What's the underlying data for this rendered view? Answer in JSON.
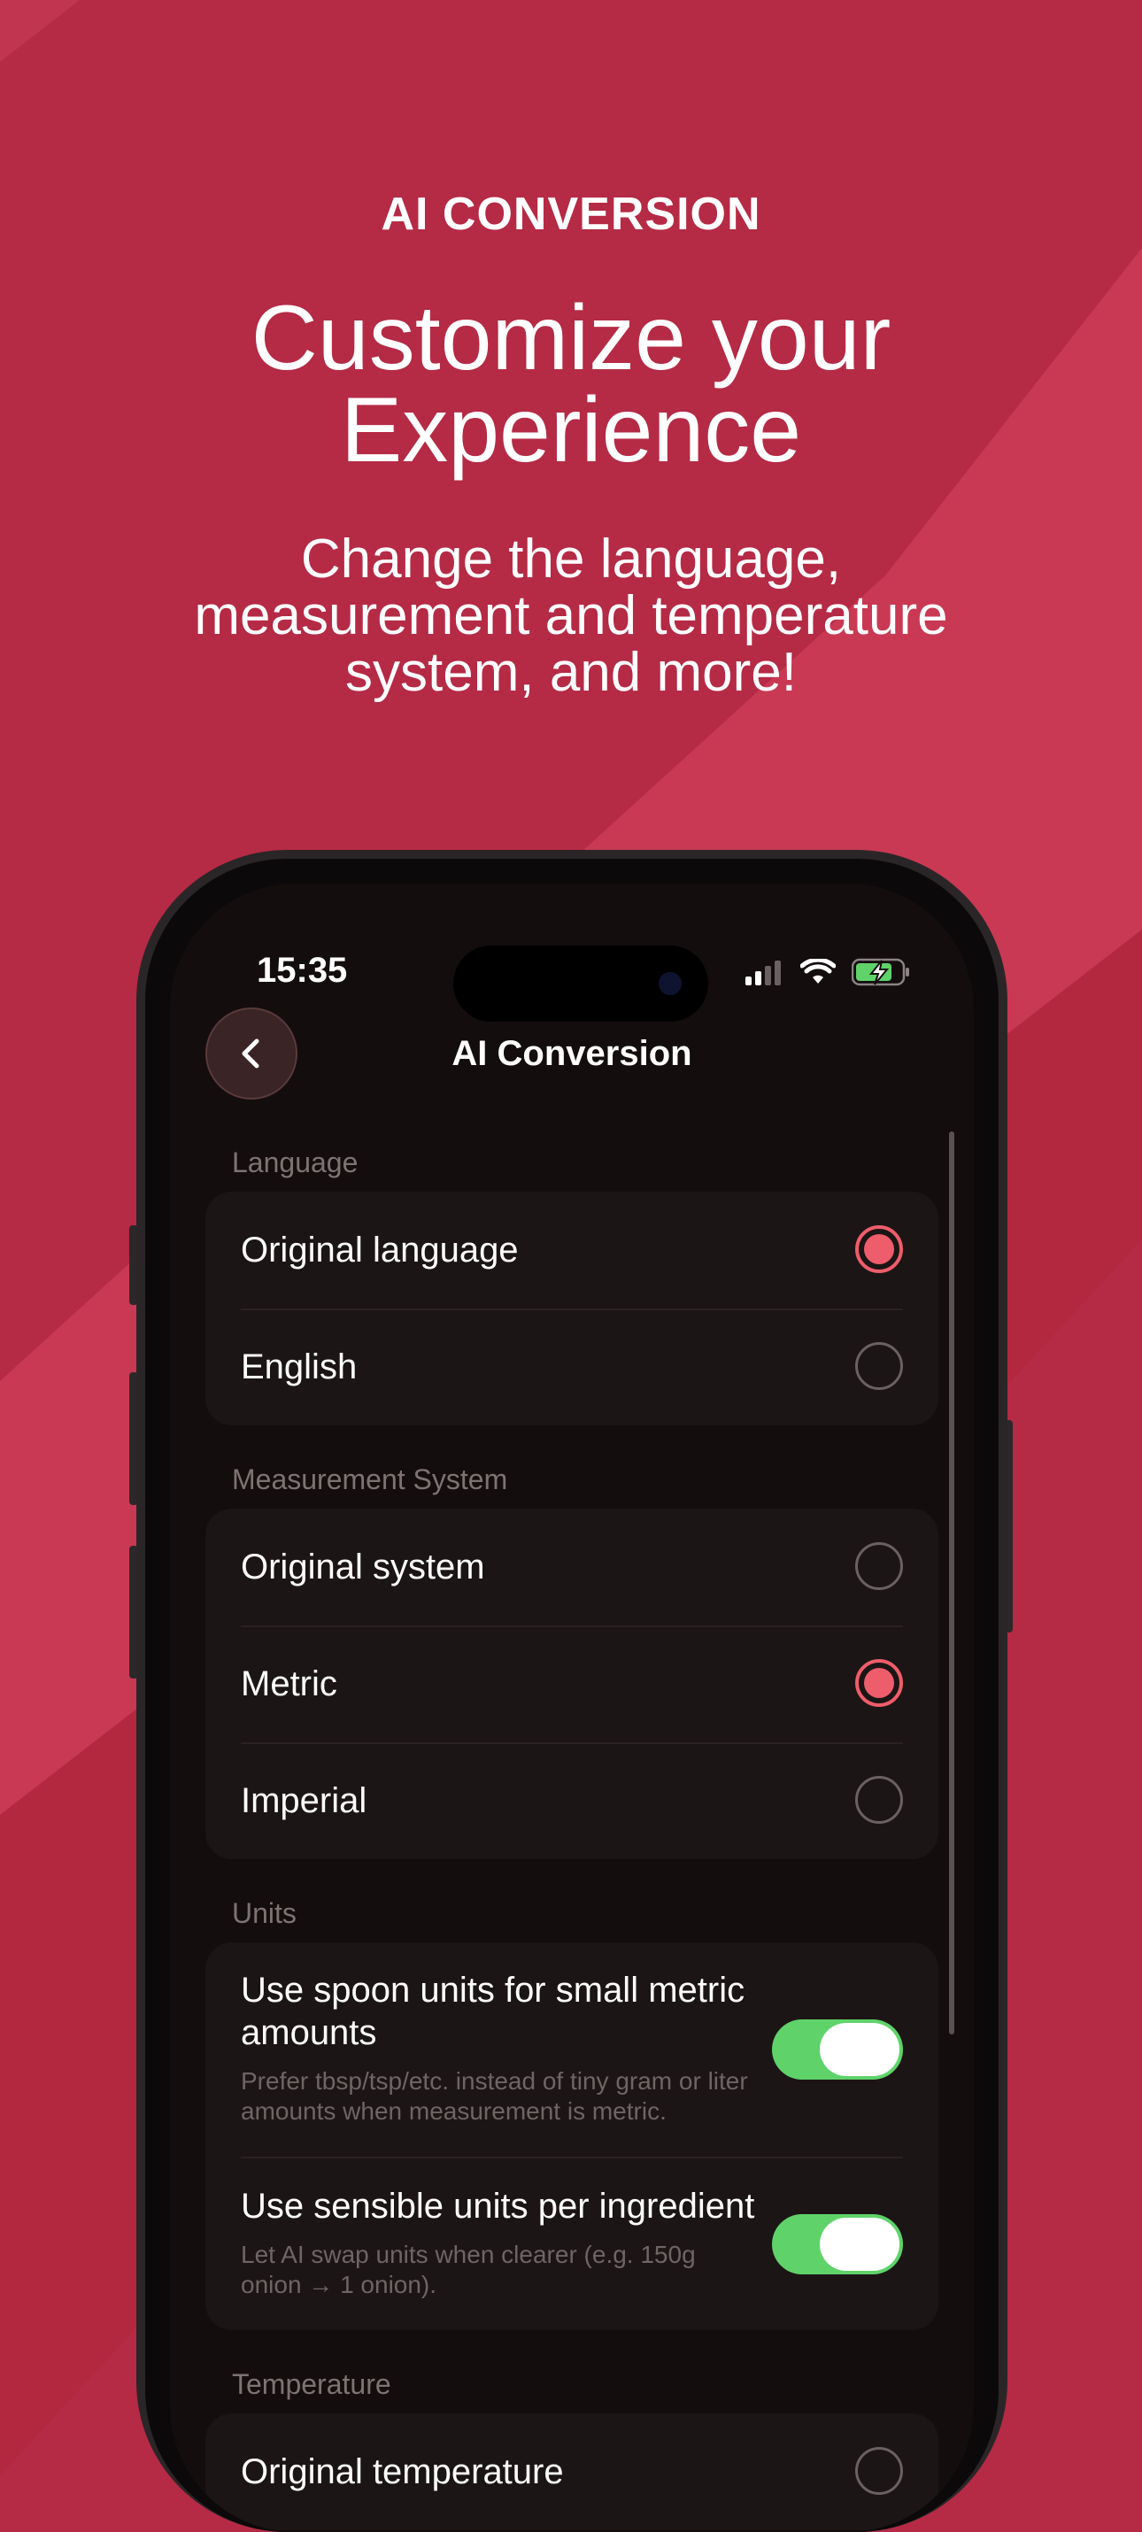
{
  "colors": {
    "background": "#b52a45",
    "accent": "#ee5d6b",
    "toggle_on": "#5fd36a"
  },
  "hero": {
    "eyebrow": "AI CONVERSION",
    "headline_line1": "Customize your",
    "headline_line2": "Experience",
    "subhead_line1": "Change the language,",
    "subhead_line2": "measurement and temperature",
    "subhead_line3": "system, and more!"
  },
  "status": {
    "time": "15:35",
    "icons": [
      "cellular-signal-icon",
      "wifi-icon",
      "battery-charging-icon"
    ]
  },
  "nav": {
    "back_icon": "chevron-left-icon",
    "title": "AI Conversion"
  },
  "sections": {
    "language": {
      "label": "Language",
      "options": [
        {
          "label": "Original language",
          "selected": true
        },
        {
          "label": "English",
          "selected": false
        }
      ]
    },
    "measurement": {
      "label": "Measurement System",
      "options": [
        {
          "label": "Original system",
          "selected": false
        },
        {
          "label": "Metric",
          "selected": true
        },
        {
          "label": "Imperial",
          "selected": false
        }
      ]
    },
    "units": {
      "label": "Units",
      "toggles": [
        {
          "title": "Use spoon units for small metric amounts",
          "description": "Prefer tbsp/tsp/etc. instead of tiny gram or liter amounts when measurement is metric.",
          "on": true
        },
        {
          "title": "Use sensible units per ingredient",
          "description": "Let AI swap units when clearer (e.g. 150g onion → 1 onion).",
          "on": true
        }
      ]
    },
    "temperature": {
      "label": "Temperature",
      "options": [
        {
          "label": "Original temperature",
          "selected": false
        }
      ]
    }
  }
}
